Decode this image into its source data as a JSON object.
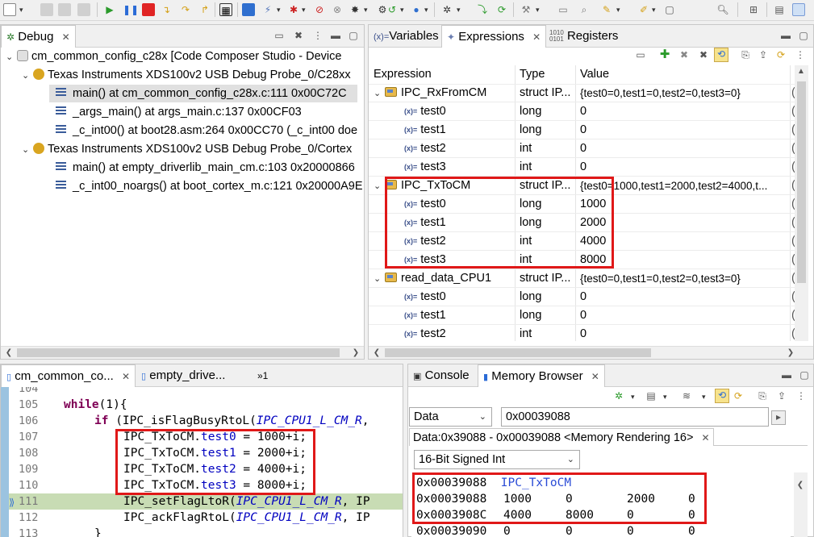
{
  "debug_view": {
    "tab_label": "Debug",
    "tree": [
      {
        "label": "cm_common_config_c28x [Code Composer Studio - Device"
      },
      {
        "label": "Texas Instruments XDS100v2 USB Debug Probe_0/C28xx"
      },
      {
        "label": "main() at cm_common_config_c28x.c:111 0x00C72C"
      },
      {
        "label": "_args_main() at args_main.c:137 0x00CF03"
      },
      {
        "label": "_c_int00() at boot28.asm:264 0x00CC70  (_c_int00 doe"
      },
      {
        "label": "Texas Instruments XDS100v2 USB Debug Probe_0/Cortex"
      },
      {
        "label": "main() at empty_driverlib_main_cm.c:103 0x20000866"
      },
      {
        "label": "_c_int00_noargs() at boot_cortex_m.c:121 0x20000A9E"
      }
    ]
  },
  "expressions_view": {
    "tabs": [
      "Variables",
      "Expressions",
      "Registers"
    ],
    "columns": [
      "Expression",
      "Type",
      "Value"
    ],
    "rows": [
      {
        "name": "IPC_RxFromCM",
        "type": "struct IP...",
        "value": "{test0=0,test1=0,test2=0,test3=0}"
      },
      {
        "name": "test0",
        "type": "long",
        "value": "0"
      },
      {
        "name": "test1",
        "type": "long",
        "value": "0"
      },
      {
        "name": "test2",
        "type": "int",
        "value": "0"
      },
      {
        "name": "test3",
        "type": "int",
        "value": "0"
      },
      {
        "name": "IPC_TxToCM",
        "type": "struct IP...",
        "value": "{test0=1000,test1=2000,test2=4000,t..."
      },
      {
        "name": "test0",
        "type": "long",
        "value": "1000"
      },
      {
        "name": "test1",
        "type": "long",
        "value": "2000"
      },
      {
        "name": "test2",
        "type": "int",
        "value": "4000"
      },
      {
        "name": "test3",
        "type": "int",
        "value": "8000"
      },
      {
        "name": "read_data_CPU1",
        "type": "struct IP...",
        "value": "{test0=0,test1=0,test2=0,test3=0}"
      },
      {
        "name": "test0",
        "type": "long",
        "value": "0"
      },
      {
        "name": "test1",
        "type": "long",
        "value": "0"
      },
      {
        "name": "test2",
        "type": "int",
        "value": "0"
      }
    ],
    "trailing_column_glyph": "("
  },
  "editor": {
    "tabs": [
      "cm_common_co...",
      "empty_drive..."
    ],
    "overflow_label": "»1",
    "lines": [
      {
        "num": "104",
        "text": ""
      },
      {
        "num": "105",
        "text": "    while(1){"
      },
      {
        "num": "106",
        "text": "        if (IPC_isFlagBusyRtoL(IPC_CPU1_L_CM_R,"
      },
      {
        "num": "107",
        "text": "            IPC_TxToCM.test0 = 1000+i;"
      },
      {
        "num": "108",
        "text": "            IPC_TxToCM.test1 = 2000+i;"
      },
      {
        "num": "109",
        "text": "            IPC_TxToCM.test2 = 4000+i;"
      },
      {
        "num": "110",
        "text": "            IPC_TxToCM.test3 = 8000+i;"
      },
      {
        "num": "111",
        "text": "            IPC_setFlagLtoR(IPC_CPU1_L_CM_R, IP"
      },
      {
        "num": "112",
        "text": "            IPC_ackFlagRtoL(IPC_CPU1_L_CM_R, IP"
      },
      {
        "num": "113",
        "text": "        }"
      }
    ]
  },
  "memory_view": {
    "tabs": [
      "Console",
      "Memory Browser"
    ],
    "space": "Data",
    "address_input": "0x00039088",
    "rendering_tab": "Data:0x39088 - 0x00039088 <Memory Rendering 16>",
    "format": "16-Bit Signed Int",
    "rows": [
      {
        "addr": "0x00039088",
        "cells": [
          "IPC_TxToCM"
        ]
      },
      {
        "addr": "0x00039088",
        "cells": [
          "1000",
          "0",
          "2000",
          "0"
        ]
      },
      {
        "addr": "0x0003908C",
        "cells": [
          "4000",
          "8000",
          "0",
          "0"
        ]
      },
      {
        "addr": "0x00039090",
        "cells": [
          "0",
          "0",
          "0",
          "0"
        ]
      }
    ]
  },
  "colors": {
    "highlight_box": "#e01818",
    "current_line": "#c8dcb4",
    "keyword": "#7f0055",
    "field": "#0000c0"
  }
}
